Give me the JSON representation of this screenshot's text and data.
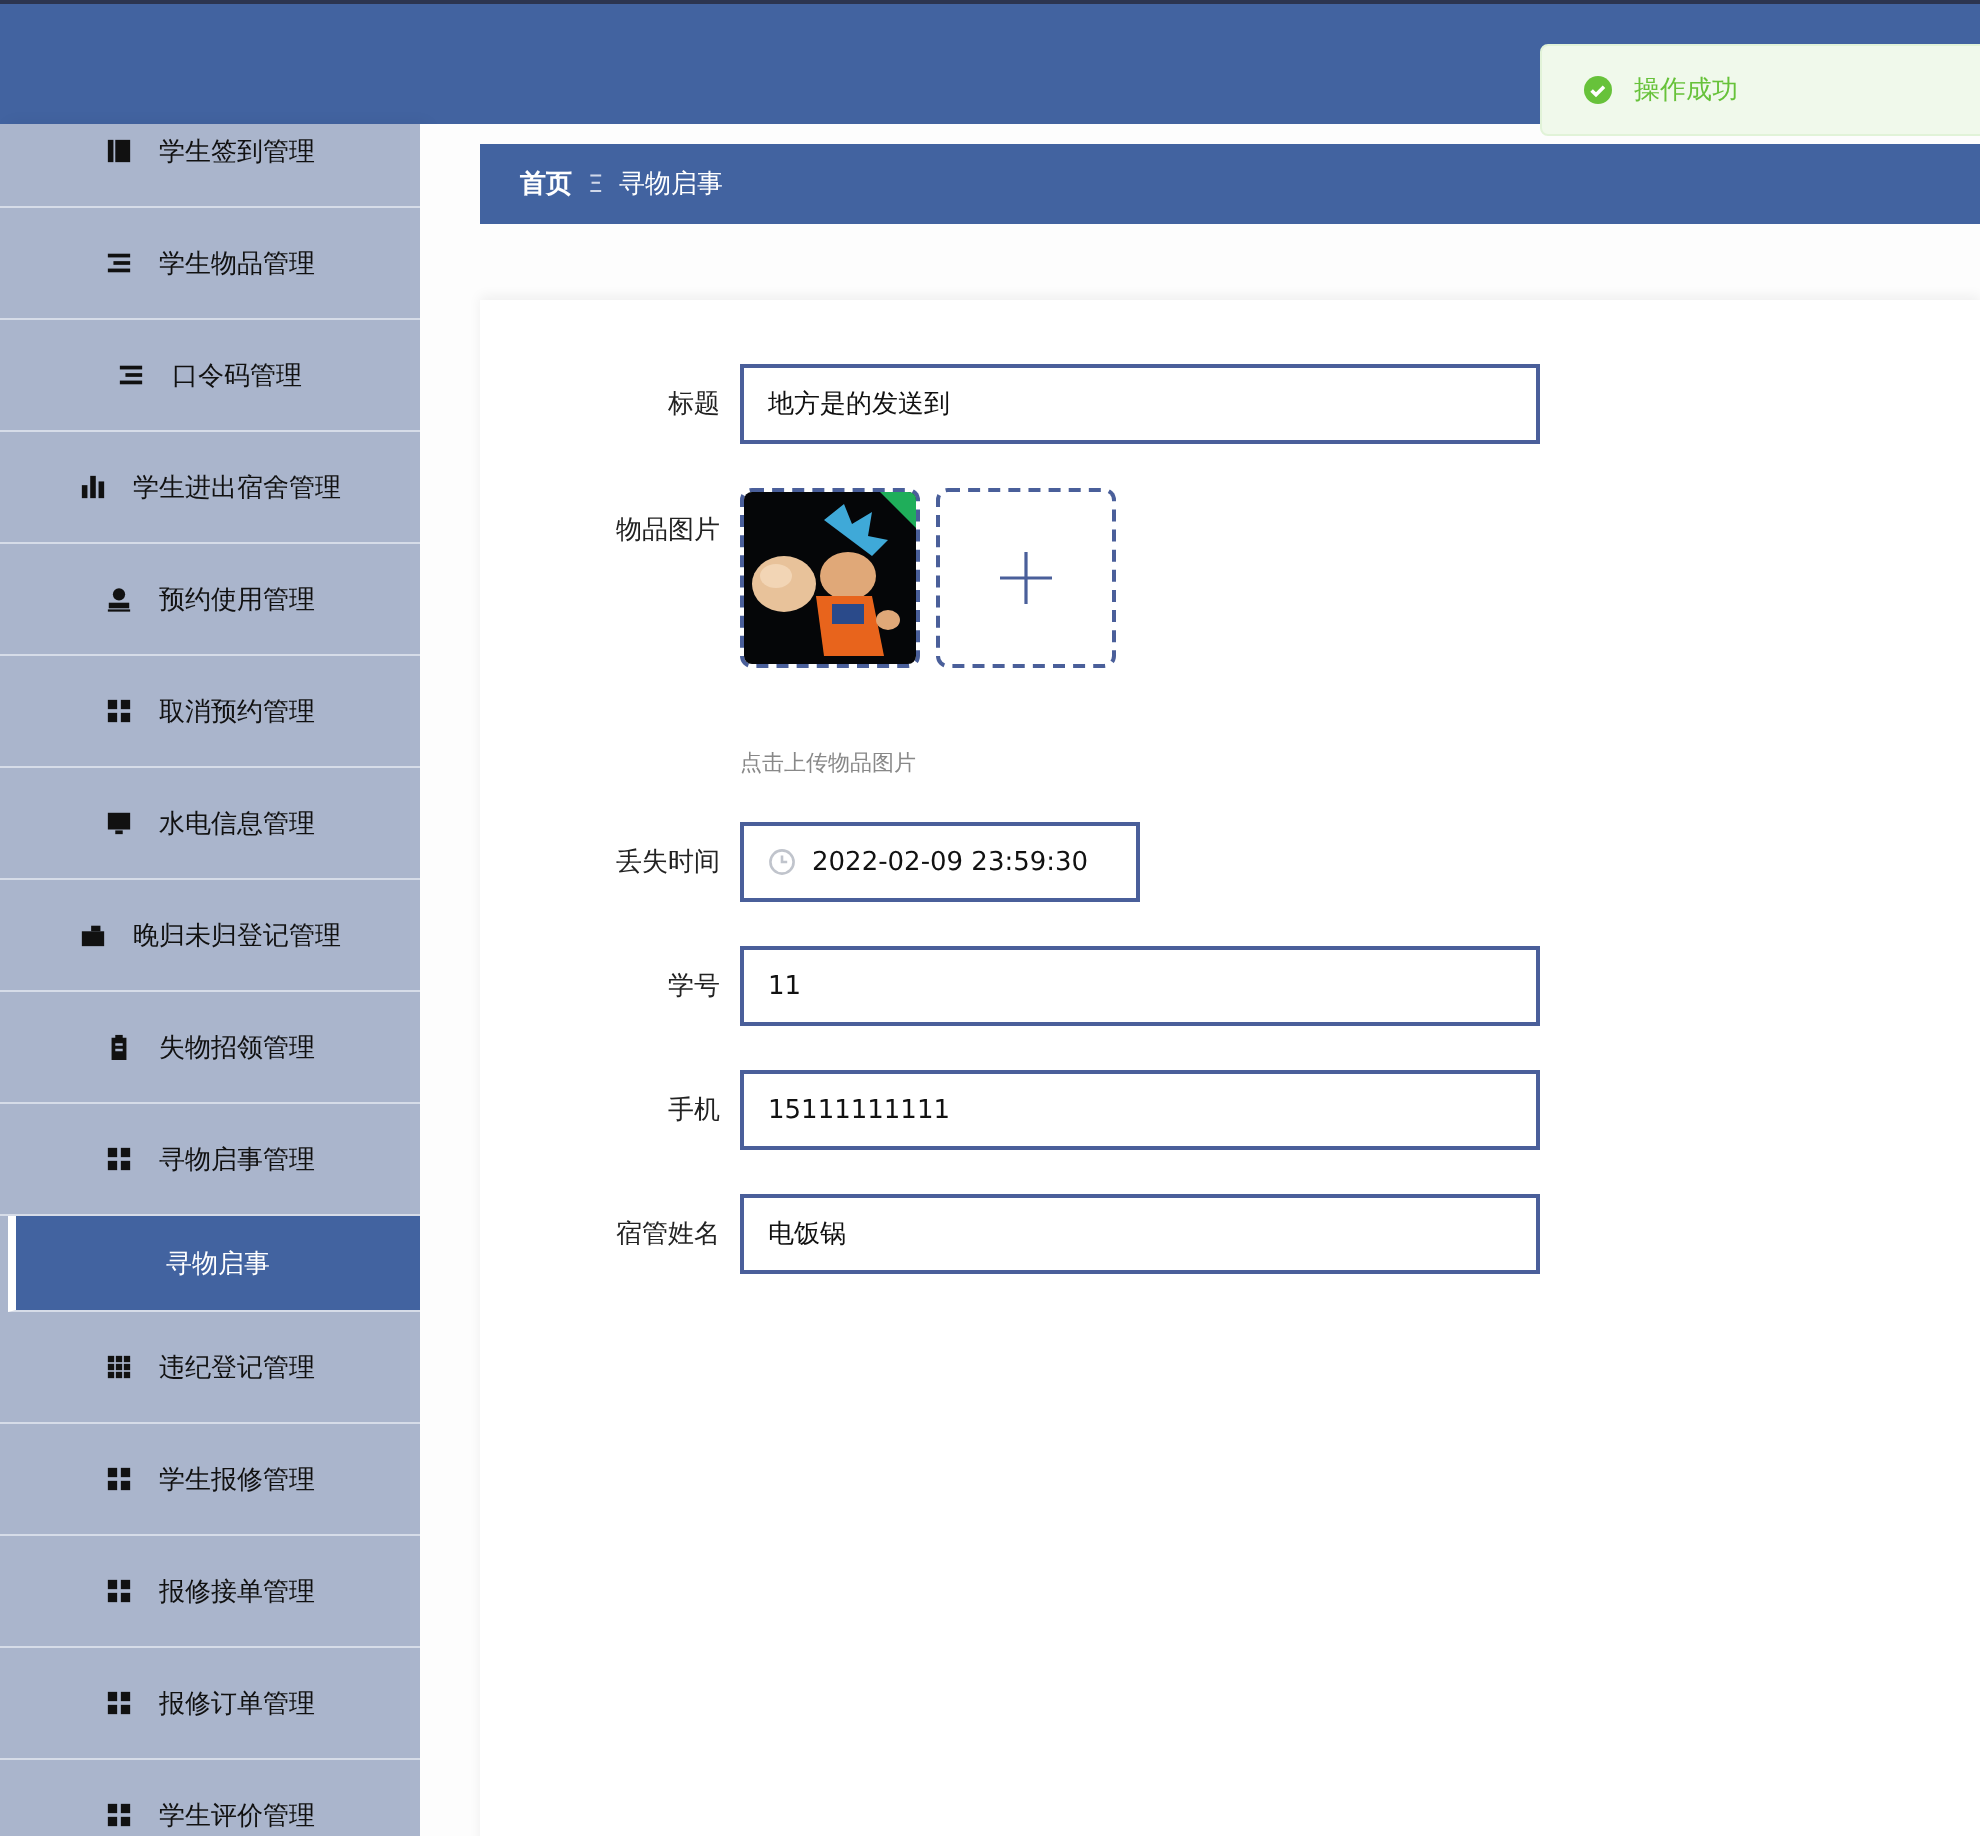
{
  "toast": {
    "message": "操作成功"
  },
  "sidebar": {
    "items": [
      {
        "label": "学生签到管理",
        "selected": false,
        "kind": "menu"
      },
      {
        "label": "学生物品管理",
        "selected": false,
        "kind": "menu"
      },
      {
        "label": "口令码管理",
        "selected": false,
        "kind": "menu"
      },
      {
        "label": "学生进出宿舍管理",
        "selected": false,
        "kind": "menu"
      },
      {
        "label": "预约使用管理",
        "selected": false,
        "kind": "menu"
      },
      {
        "label": "取消预约管理",
        "selected": false,
        "kind": "menu"
      },
      {
        "label": "水电信息管理",
        "selected": false,
        "kind": "menu"
      },
      {
        "label": "晚归未归登记管理",
        "selected": false,
        "kind": "menu"
      },
      {
        "label": "失物招领管理",
        "selected": false,
        "kind": "menu"
      },
      {
        "label": "寻物启事管理",
        "selected": false,
        "kind": "menu"
      },
      {
        "label": "寻物启事",
        "selected": true,
        "kind": "submenu"
      },
      {
        "label": "违纪登记管理",
        "selected": false,
        "kind": "menu"
      },
      {
        "label": "学生报修管理",
        "selected": false,
        "kind": "menu"
      },
      {
        "label": "报修接单管理",
        "selected": false,
        "kind": "menu"
      },
      {
        "label": "报修订单管理",
        "selected": false,
        "kind": "menu"
      },
      {
        "label": "学生评价管理",
        "selected": false,
        "kind": "menu"
      }
    ]
  },
  "breadcrumb": {
    "items": [
      "首页",
      "寻物启事"
    ],
    "separator": "Ξ"
  },
  "form": {
    "fields": [
      {
        "kind": "text",
        "label": "标题",
        "value": "地方是的发送到"
      },
      {
        "kind": "images",
        "label": "物品图片",
        "hint": "点击上传物品图片"
      },
      {
        "kind": "date",
        "label": "丢失时间",
        "value": "2022-02-09 23:59:30"
      },
      {
        "kind": "text",
        "label": "学号",
        "value": "11"
      },
      {
        "kind": "text",
        "label": "手机",
        "value": "15111111111"
      },
      {
        "kind": "text",
        "label": "宿管姓名",
        "value": "电饭锅"
      }
    ]
  }
}
